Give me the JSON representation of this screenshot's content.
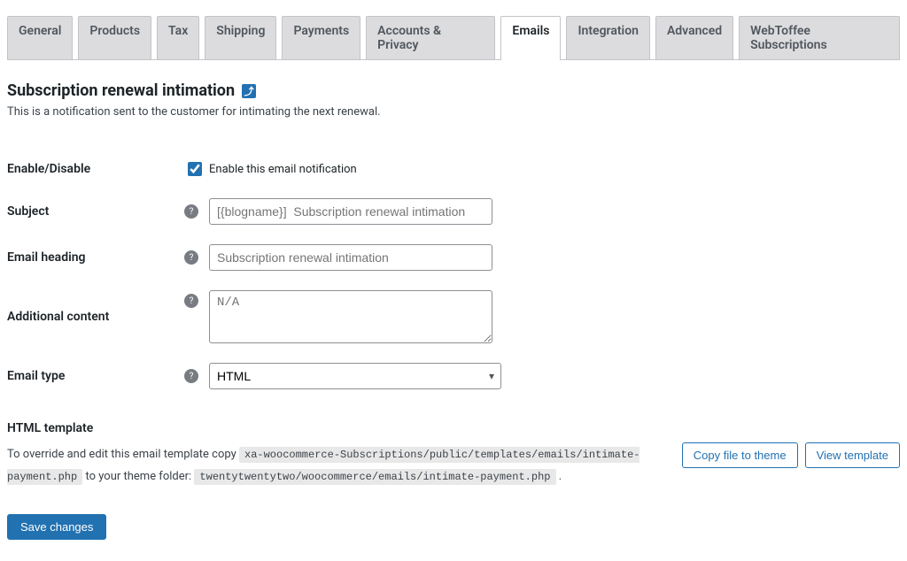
{
  "tabs": {
    "items": [
      {
        "label": "General"
      },
      {
        "label": "Products"
      },
      {
        "label": "Tax"
      },
      {
        "label": "Shipping"
      },
      {
        "label": "Payments"
      },
      {
        "label": "Accounts & Privacy"
      },
      {
        "label": "Emails",
        "active": true
      },
      {
        "label": "Integration"
      },
      {
        "label": "Advanced"
      },
      {
        "label": "WebToffee Subscriptions"
      }
    ]
  },
  "section": {
    "title": "Subscription renewal intimation",
    "back_badge": "⤴",
    "description": "This is a notification sent to the customer for intimating the next renewal."
  },
  "form": {
    "enable": {
      "label": "Enable/Disable",
      "checkbox_label": "Enable this email notification",
      "checked": true
    },
    "subject": {
      "label": "Subject",
      "placeholder": "[{blogname}]  Subscription renewal intimation",
      "value": ""
    },
    "heading": {
      "label": "Email heading",
      "placeholder": "Subscription renewal intimation",
      "value": ""
    },
    "additional": {
      "label": "Additional content",
      "placeholder": "N/A",
      "value": ""
    },
    "type": {
      "label": "Email type",
      "value": "HTML"
    }
  },
  "template": {
    "heading": "HTML template",
    "pre": "To override and edit this email template copy",
    "src_path": "xa-woocommerce-Subscriptions/public/templates/emails/intimate-payment.php",
    "mid": "to your theme folder:",
    "dest_path": "twentytwentytwo/woocommerce/emails/intimate-payment.php",
    "post": ".",
    "btn_copy": "Copy file to theme",
    "btn_view": "View template"
  },
  "save": {
    "label": "Save changes"
  },
  "help_glyph": "?"
}
